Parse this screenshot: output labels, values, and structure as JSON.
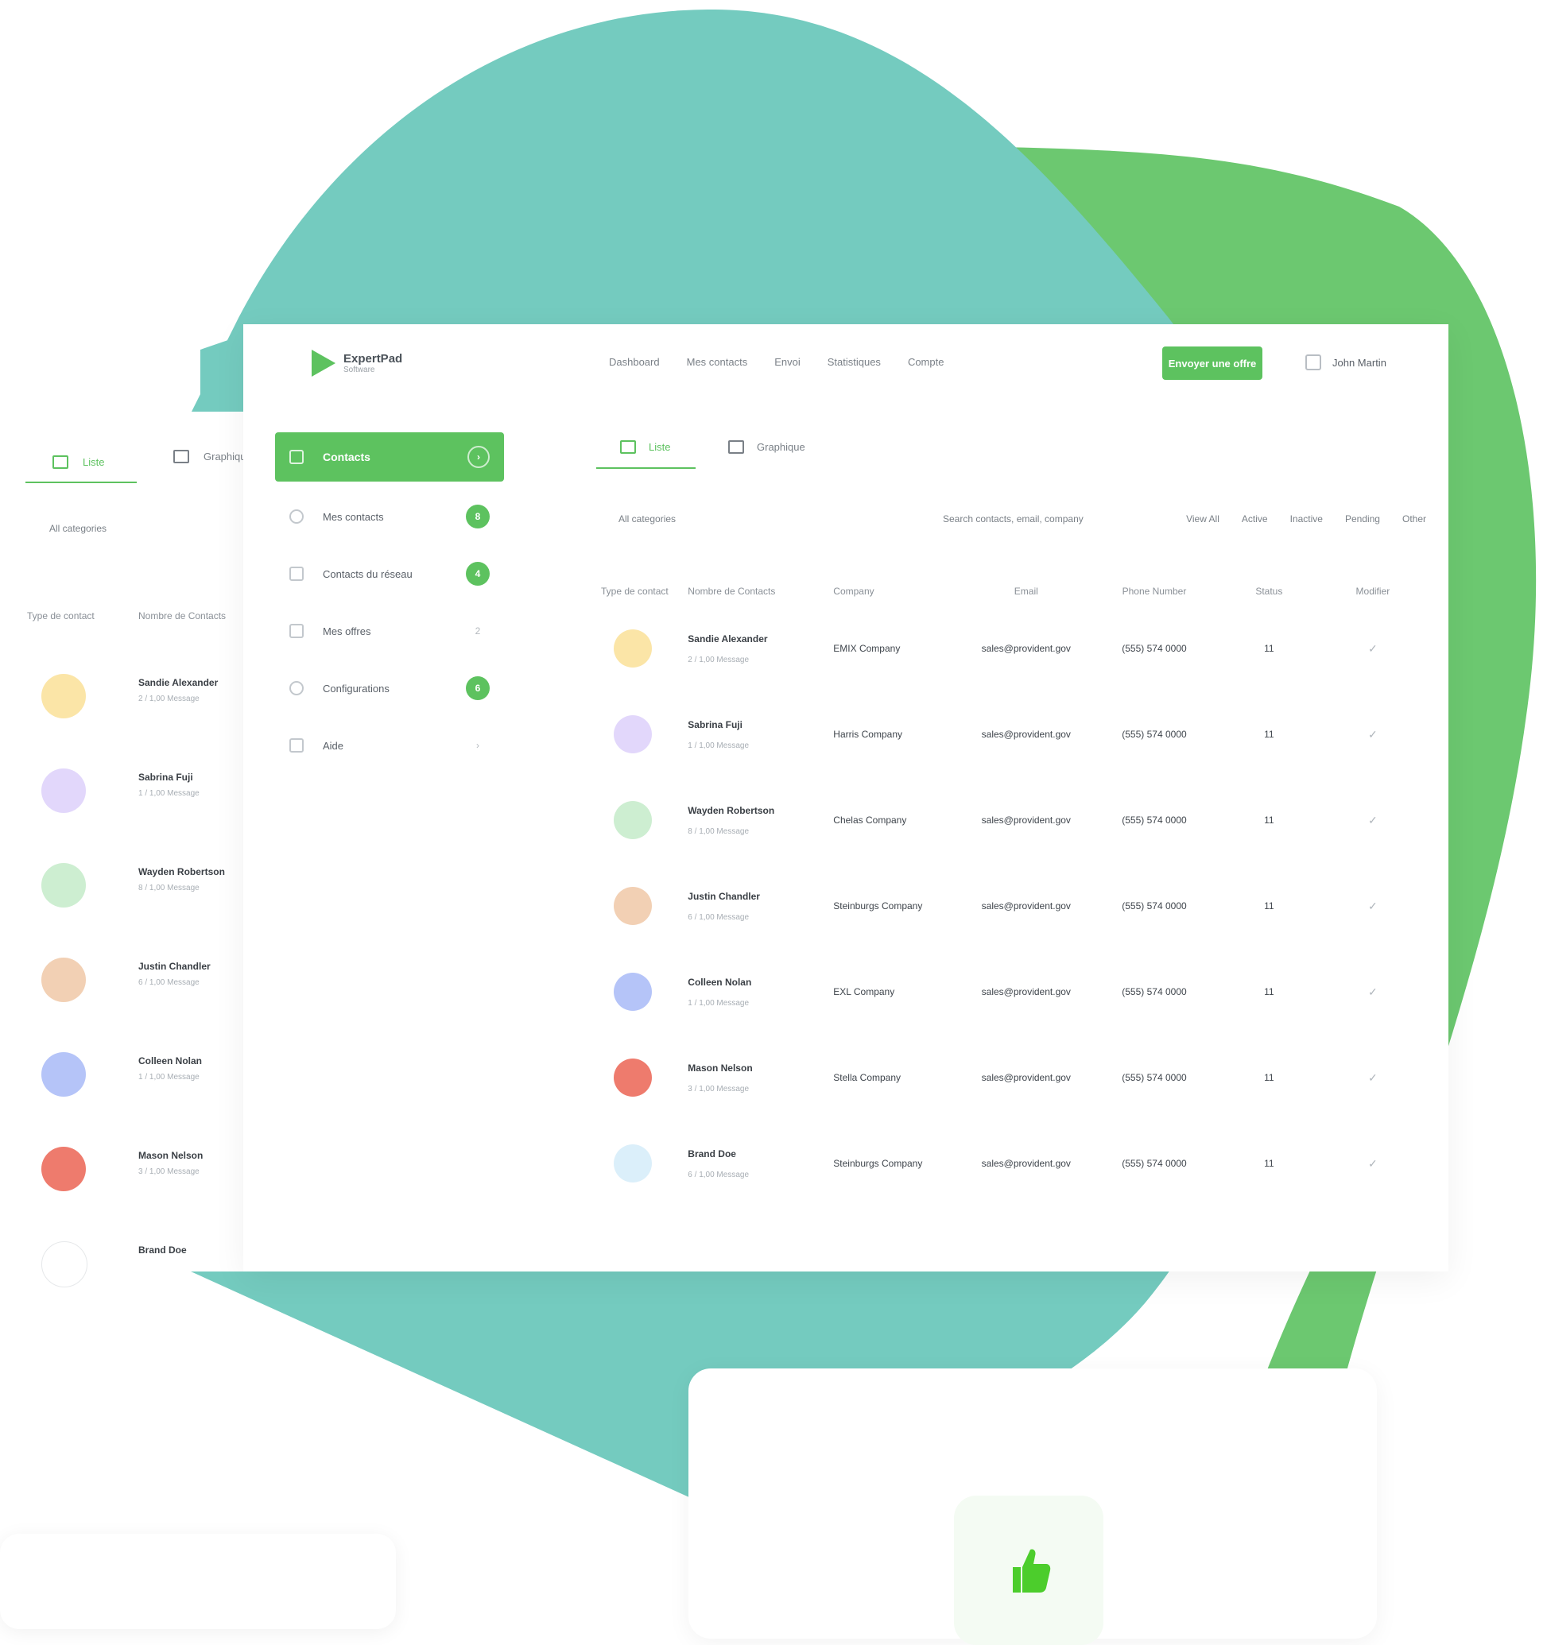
{
  "colors": {
    "teal": "#74cbbf",
    "green": "#6cc870",
    "accent": "#5dc25f",
    "white": "#ffffff"
  },
  "header": {
    "logo_text": "ExpertPad",
    "logo_sub": "Software",
    "nav": [
      "Dashboard",
      "Mes contacts",
      "Envoi",
      "Statistiques",
      "Compte"
    ],
    "cta_label": "Envoyer une offre",
    "user_name": "John Martin"
  },
  "sidebar": {
    "items": [
      {
        "label": "Contacts",
        "icon": "users-icon",
        "badge": "›"
      },
      {
        "label": "Mes contacts",
        "icon": "user-icon",
        "badge": "8"
      },
      {
        "label": "Contacts du réseau",
        "icon": "network-icon",
        "badge": "4"
      },
      {
        "label": "Mes offres",
        "icon": "offer-icon",
        "badge": "2"
      },
      {
        "label": "Configurations",
        "icon": "settings-icon",
        "badge": "6"
      },
      {
        "label": "Aide",
        "icon": "help-icon",
        "badge": "›"
      }
    ]
  },
  "main": {
    "tabs": [
      {
        "label": "Liste",
        "icon": "list-icon"
      },
      {
        "label": "Graphique",
        "icon": "chart-icon"
      }
    ],
    "filter_left": "All categories",
    "filter_mid": "Search contacts, email, company",
    "filter_right": [
      "View All",
      "Active",
      "Inactive",
      "Pending",
      "Other"
    ],
    "table": {
      "headers": [
        "Type de contact",
        "Nombre de Contacts",
        "Company",
        "Email",
        "Phone Number",
        "Status",
        "Modifier"
      ],
      "rows": [
        {
          "avatar_color": "#fbe5a7",
          "name": "Sandie Alexander",
          "sub": "2 / 1,00 Message",
          "company": "EMIX Company",
          "email": "sales@provident.gov",
          "phone": "(555) 574 0000",
          "status": "11",
          "check": "✓"
        },
        {
          "avatar_color": "#e2d7fb",
          "name": "Sabrina Fuji",
          "sub": "1 / 1,00 Message",
          "company": "Harris Company",
          "email": "sales@provident.gov",
          "phone": "(555) 574 0000",
          "status": "11",
          "check": "✓"
        },
        {
          "avatar_color": "#cdeed1",
          "name": "Wayden Robertson",
          "sub": "8 / 1,00 Message",
          "company": "Chelas Company",
          "email": "sales@provident.gov",
          "phone": "(555) 574 0000",
          "status": "11",
          "check": "✓"
        },
        {
          "avatar_color": "#f2d0b4",
          "name": "Justin Chandler",
          "sub": "6 / 1,00 Message",
          "company": "Steinburgs Company",
          "email": "sales@provident.gov",
          "phone": "(555) 574 0000",
          "status": "11",
          "check": "✓"
        },
        {
          "avatar_color": "#b5c4f8",
          "name": "Colleen Nolan",
          "sub": "1 / 1,00 Message",
          "company": "EXL Company",
          "email": "sales@provident.gov",
          "phone": "(555) 574 0000",
          "status": "11",
          "check": "✓"
        },
        {
          "avatar_color": "#ee7b6d",
          "name": "Mason Nelson",
          "sub": "3 / 1,00 Message",
          "company": "Stella Company",
          "email": "sales@provident.gov",
          "phone": "(555) 574 0000",
          "status": "11",
          "check": "✓"
        },
        {
          "avatar_color": "#dbeffa",
          "name": "Brand Doe",
          "sub": "6 / 1,00 Message",
          "company": "Steinburgs Company",
          "email": "sales@provident.gov",
          "phone": "(555) 574 0000",
          "status": "11",
          "check": "✓"
        }
      ]
    }
  },
  "left_panel": {
    "tabs": [
      "Liste",
      "Graphique"
    ],
    "filter": "All categories",
    "headers": [
      "Type de contact",
      "Nombre de Contacts"
    ],
    "rows": [
      {
        "avatar_color": "#fbe5a7",
        "name": "Sandie Alexander",
        "sub": "2 / 1,00 Message"
      },
      {
        "avatar_color": "#e2d7fb",
        "name": "Sabrina Fuji",
        "sub": "1 / 1,00 Message"
      },
      {
        "avatar_color": "#cdeed1",
        "name": "Wayden Robertson",
        "sub": "8 / 1,00 Message"
      },
      {
        "avatar_color": "#f2d0b4",
        "name": "Justin Chandler",
        "sub": "6 / 1,00 Message"
      },
      {
        "avatar_color": "#b5c4f8",
        "name": "Colleen Nolan",
        "sub": "1 / 1,00 Message"
      },
      {
        "avatar_color": "#ee7b6d",
        "name": "Mason Nelson",
        "sub": "3 / 1,00 Message"
      },
      {
        "avatar_color": "#ffffff",
        "name": "Brand Doe",
        "sub": ""
      }
    ]
  },
  "card": {
    "icon": "thumbs-up-icon"
  }
}
